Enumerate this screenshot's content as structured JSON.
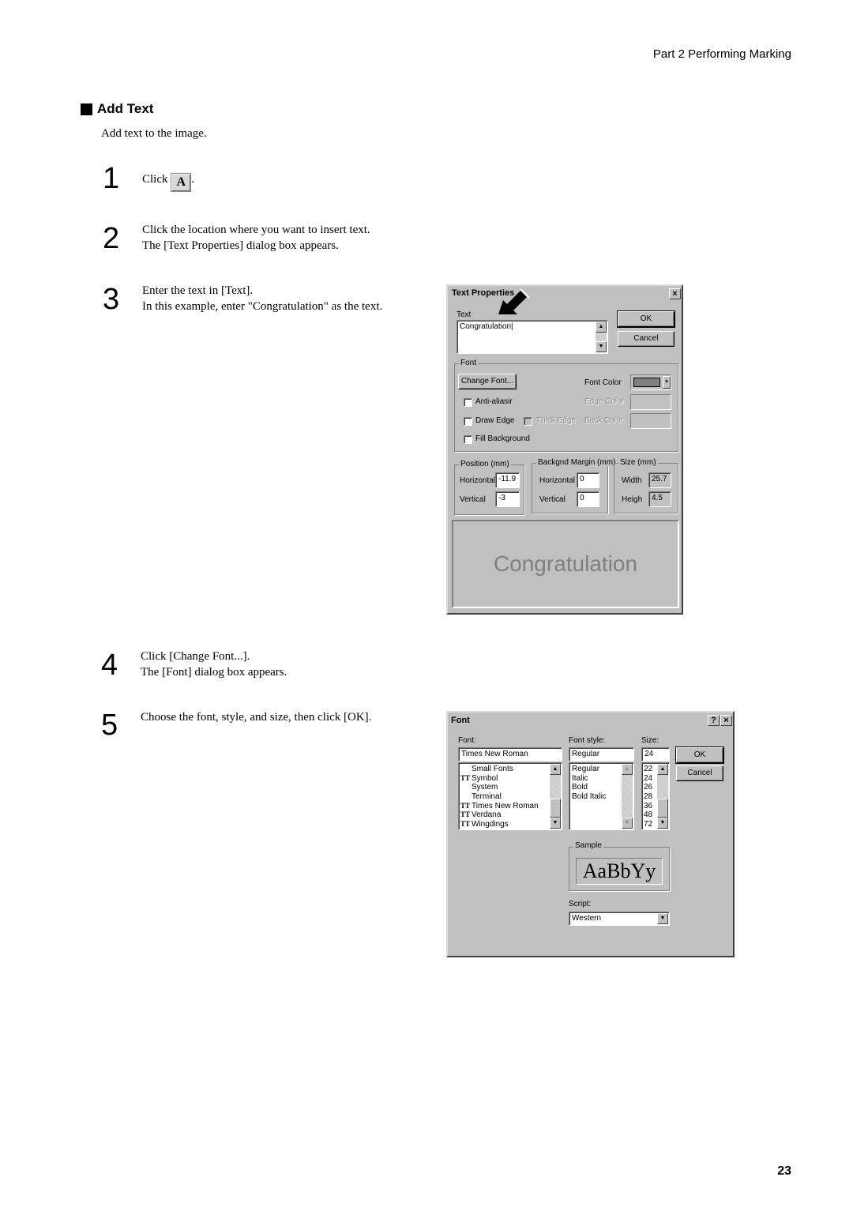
{
  "header": "Part 2  Performing Marking",
  "section_title": "Add Text",
  "intro": "Add text to the image.",
  "steps": [
    {
      "num": "1",
      "lines": [
        "Click",
        ""
      ]
    },
    {
      "num": "2",
      "lines": [
        "Click the location where you want to insert text.",
        "The [Text Properties] dialog box appears."
      ]
    },
    {
      "num": "3",
      "lines": [
        "Enter the text in [Text].",
        "In this example, enter \"Congratulation\" as the text."
      ]
    },
    {
      "num": "4",
      "lines": [
        "Click [Change Font...].",
        "The [Font] dialog box appears."
      ]
    },
    {
      "num": "5",
      "lines": [
        "Choose the font, style, and size, then click [OK]."
      ]
    }
  ],
  "text_tool_icon": "A",
  "text_props": {
    "title": "Text Properties",
    "close": "×",
    "text_label": "Text",
    "text_value": "Congratulation",
    "ok": "OK",
    "cancel": "Cancel",
    "font_group": "Font",
    "change_font": "Change Font...",
    "font_color": "Font Color",
    "font_color_value": "#808080",
    "anti_alias": "Anti-aliasir",
    "edge_color": "Edge Color",
    "draw_edge": "Draw Edge",
    "thick_edge": "Thick Edge",
    "back_color": "Back Color",
    "fill_background": "Fill Background",
    "position_group": "Position (mm)",
    "pos_h_label": "Horizontal",
    "pos_h": "-11.9",
    "pos_v_label": "Vertical",
    "pos_v": "-3",
    "margin_group": "Backgnd Margin (mm)",
    "mar_h_label": "Horizontal",
    "mar_h": "0",
    "mar_v_label": "Vertical",
    "mar_v": "0",
    "size_group": "Size (mm)",
    "width_label": "Width",
    "width": "25.7",
    "height_label": "Heigh",
    "height": "4.5",
    "preview": "Congratulation"
  },
  "font_dlg": {
    "title": "Font",
    "help": "?",
    "close": "×",
    "font_label": "Font:",
    "font_value": "Times New Roman",
    "fonts": [
      {
        "name": "Small Fonts",
        "tt": false
      },
      {
        "name": "Symbol",
        "tt": true
      },
      {
        "name": "System",
        "tt": false
      },
      {
        "name": "Terminal",
        "tt": false
      },
      {
        "name": "Times New Roman",
        "tt": true
      },
      {
        "name": "Verdana",
        "tt": true
      },
      {
        "name": "Wingdings",
        "tt": true
      }
    ],
    "style_label": "Font style:",
    "style_value": "Regular",
    "styles": [
      "Regular",
      "Italic",
      "Bold",
      "Bold Italic"
    ],
    "size_label": "Size:",
    "size_value": "24",
    "sizes": [
      "22",
      "24",
      "26",
      "28",
      "36",
      "48",
      "72"
    ],
    "ok": "OK",
    "cancel": "Cancel",
    "sample_label": "Sample",
    "sample": "AaBbYy",
    "script_label": "Script:",
    "script_value": "Western"
  },
  "page_number": "23"
}
